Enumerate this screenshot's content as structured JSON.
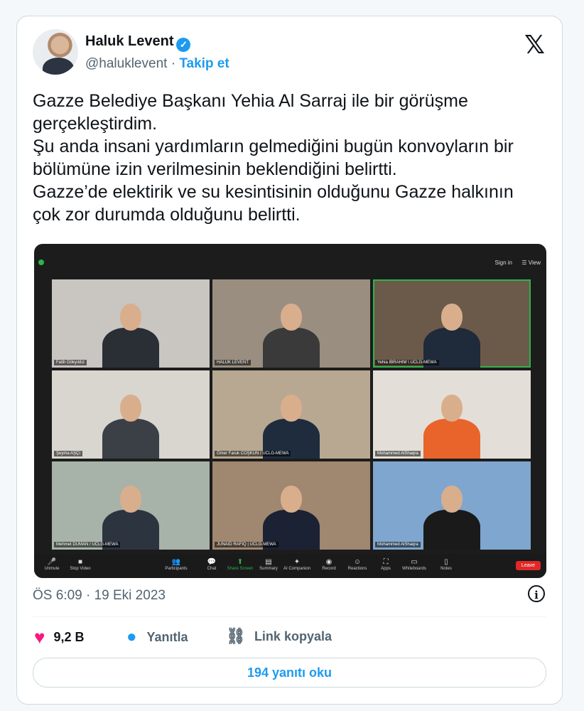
{
  "tweet": {
    "author_name": "Haluk Levent",
    "handle": "@haluklevent",
    "separator": "·",
    "follow_label": "Takip et",
    "platform_logo": "𝕏",
    "lines": [
      "Gazze Belediye Başkanı Yehia Al Sarraj ile bir görüşme gerçekleştirdim.",
      "Şu anda insani yardımların gelmediğini bugün konvoyların bir bölümüne izin verilmesinin beklendiğini belirtti.",
      "Gazze’de elektirik ve su kesintisinin olduğunu Gazze halkının çok zor durumda olduğunu belirtti."
    ],
    "timestamp": "ÖS 6:09 · 19 Eki 2023",
    "like_count": "9,2 B",
    "reply_label": "Yanıtla",
    "copy_link_label": "Link kopyala",
    "read_replies_label": "194 yanıtı oku"
  },
  "meeting": {
    "sign_in": "Sign in",
    "view": "☰ View",
    "participants": [
      {
        "name": "Fatih Gökyıldız",
        "muted": false,
        "bg": "#c9c6c2",
        "shirt": "#2a2e35",
        "active": false
      },
      {
        "name": "HALUK LEVENT",
        "muted": true,
        "bg": "#9a8e80",
        "shirt": "#3a3a3a",
        "active": false
      },
      {
        "name": "Yehia IBRAHIM \\ UCLG-MEWA",
        "muted": false,
        "bg": "#6b5a4a",
        "shirt": "#1f2a3a",
        "active": true
      },
      {
        "name": "Şeyma AŞÇI",
        "muted": true,
        "bg": "#d9d6cf",
        "shirt": "#3b3f46",
        "active": false
      },
      {
        "name": "Ömer Faruk COŞKUN / UCLG-MEWA",
        "muted": true,
        "bg": "#b8a892",
        "shirt": "#1e2c3e",
        "active": false
      },
      {
        "name": "Mohammed AlShaqra",
        "muted": false,
        "bg": "#e3dfd8",
        "shirt": "#e8642a",
        "active": false
      },
      {
        "name": "Mehmet DUMAN / UCLG-MEWA",
        "muted": true,
        "bg": "#a7b3a8",
        "shirt": "#2c3440",
        "active": false
      },
      {
        "name": "JUNAID RAFIQ | UCLG-MEWA",
        "muted": true,
        "bg": "#a08770",
        "shirt": "#1b2233",
        "active": false
      },
      {
        "name": "Mohammed AlShaqra",
        "muted": true,
        "bg": "#7fa6cf",
        "shirt": "#1a1a1a",
        "active": false
      }
    ],
    "toolbar": [
      {
        "label": "Unmute",
        "icon": "🎤"
      },
      {
        "label": "Stop Video",
        "icon": "■"
      },
      {
        "label": "Participants",
        "icon": "👥"
      },
      {
        "label": "Chat",
        "icon": "💬"
      },
      {
        "label": "Share Screen",
        "icon": "⬆"
      },
      {
        "label": "Summary",
        "icon": "▤"
      },
      {
        "label": "AI Companion",
        "icon": "✦"
      },
      {
        "label": "Record",
        "icon": "◉"
      },
      {
        "label": "Reactions",
        "icon": "☺"
      },
      {
        "label": "Apps",
        "icon": "⛶"
      },
      {
        "label": "Whiteboards",
        "icon": "▭"
      },
      {
        "label": "Notes",
        "icon": "▯"
      }
    ],
    "leave_label": "Leave"
  }
}
